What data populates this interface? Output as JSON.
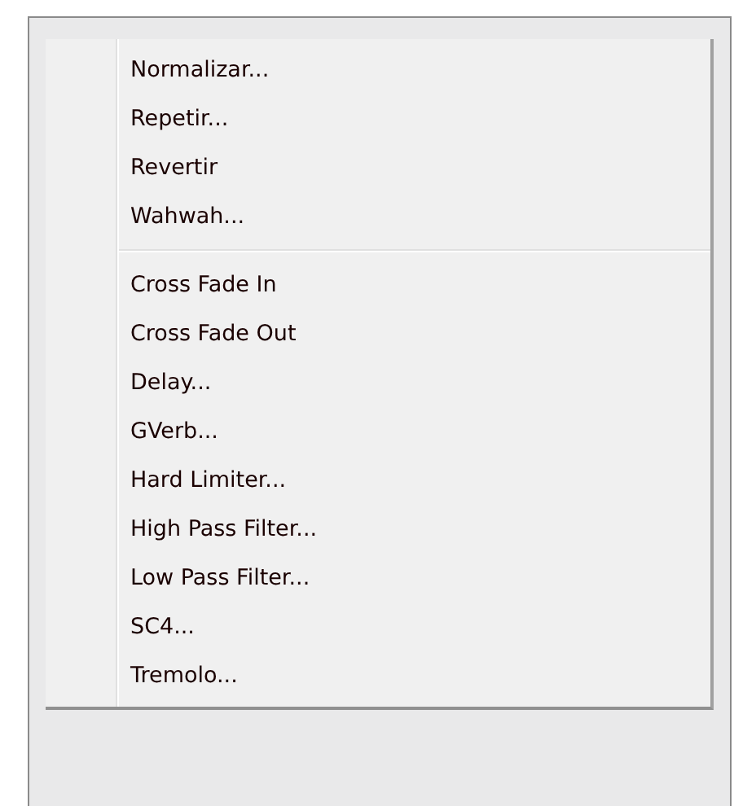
{
  "menu": {
    "items": [
      {
        "kind": "item",
        "label": "Normalizar..."
      },
      {
        "kind": "item",
        "label": "Repetir..."
      },
      {
        "kind": "item",
        "label": "Revertir"
      },
      {
        "kind": "item",
        "label": "Wahwah..."
      },
      {
        "kind": "separator"
      },
      {
        "kind": "item",
        "label": "Cross Fade In"
      },
      {
        "kind": "item",
        "label": "Cross Fade Out"
      },
      {
        "kind": "item",
        "label": "Delay..."
      },
      {
        "kind": "item",
        "label": "GVerb..."
      },
      {
        "kind": "item",
        "label": "Hard Limiter..."
      },
      {
        "kind": "item",
        "label": "High Pass Filter..."
      },
      {
        "kind": "item",
        "label": "Low Pass Filter..."
      },
      {
        "kind": "item",
        "label": "SC4..."
      },
      {
        "kind": "item",
        "label": "Tremolo..."
      }
    ]
  }
}
